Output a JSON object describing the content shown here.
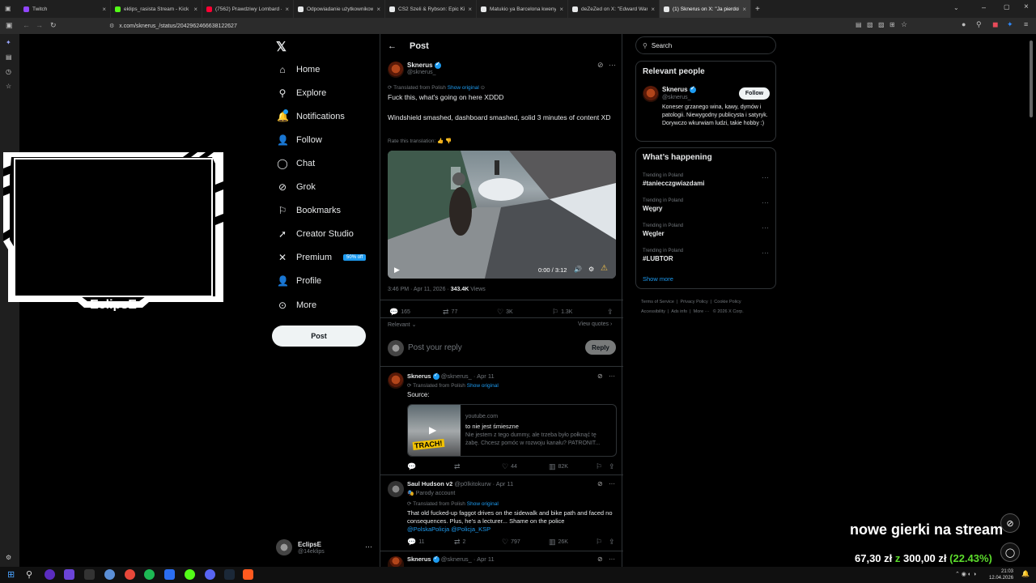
{
  "browser": {
    "tabs": [
      {
        "title": "Twitch",
        "color": "#9146ff"
      },
      {
        "title": "eklips_rasista Stream - Kick Da:",
        "color": "#53fc18"
      },
      {
        "title": "(7562) Prawdziwy Lombard - C:",
        "color": "#ff0033"
      },
      {
        "title": "Odpowiadanie użytkownikowi",
        "color": "#e7e9ea"
      },
      {
        "title": "CS2 Szeli & Rybson: Epic KickT",
        "color": "#e7e9ea"
      },
      {
        "title": "Matukio ya Barcelona kwenye",
        "color": "#e7e9ea"
      },
      {
        "title": "deZeZed on X: \"Edward Warch:",
        "color": "#e7e9ea"
      },
      {
        "title": "(1) Sknerus on X: \"Ja pierdole",
        "color": "#e7e9ea"
      }
    ],
    "url": "x.com/sknerus_/status/2042962466638122627"
  },
  "overlay": {
    "cam_name": "EclipsE",
    "stream_message": "nowe gierki na stream",
    "goal_current": "67,30 zł",
    "goal_sep": "z",
    "goal_target": "300,00 zł",
    "goal_percent": "(22.43%)"
  },
  "nav": {
    "items": [
      {
        "label": "Home",
        "icon": "home-icon"
      },
      {
        "label": "Explore",
        "icon": "search-icon"
      },
      {
        "label": "Notifications",
        "icon": "bell-icon"
      },
      {
        "label": "Follow",
        "icon": "follow-icon"
      },
      {
        "label": "Chat",
        "icon": "chat-icon"
      },
      {
        "label": "Grok",
        "icon": "grok-icon"
      },
      {
        "label": "Bookmarks",
        "icon": "bookmark-icon"
      },
      {
        "label": "Creator Studio",
        "icon": "rocket-icon"
      },
      {
        "label": "Premium",
        "icon": "x-icon"
      },
      {
        "label": "Profile",
        "icon": "profile-icon"
      },
      {
        "label": "More",
        "icon": "more-icon"
      }
    ],
    "premium_badge": "50% off",
    "post_button": "Post",
    "account_name": "EclipsE",
    "account_handle": "@14eklips"
  },
  "post": {
    "header_title": "Post",
    "author_name": "Sknerus",
    "author_handle": "@sknerus_",
    "translated_label": "Translated from Polish",
    "show_original": "Show original",
    "text1": "Fuck this, what's going on here XDDD",
    "text2": "Windshield smashed, dashboard smashed, solid 3 minutes of content XD",
    "rate_translation": "Rate this translation:",
    "video_time": "0:00 / 3:12",
    "timestamp": "3:46 PM · Apr 11, 2026 ·",
    "views_count": "343.4K",
    "views_label": "Views",
    "replies": "165",
    "reposts": "77",
    "likes": "3K",
    "bookmarks": "1.3K",
    "sort_label": "Relevant",
    "view_quotes": "View quotes",
    "reply_placeholder": "Post your reply",
    "reply_button": "Reply"
  },
  "replies": [
    {
      "name": "Sknerus",
      "handle": "@sknerus_ · Apr 11",
      "translated_label": "Translated from Polish",
      "show_original": "Show original",
      "text": "Source:",
      "card_domain": "youtube.com",
      "card_title": "to nie jest śmieszne",
      "card_desc": "Nie jestem z tego dummy, ale trzeba było połknąć tę żabę. Chcesz pomóc w rozwoju kanału? PATRONIT...",
      "thumb_label": "TRACH!",
      "replies": "",
      "reposts": "",
      "likes": "44",
      "views": "82K"
    },
    {
      "name": "Saul Hudson v2",
      "handle": "@p0lkitokurw · Apr 11",
      "parody": "Parody account",
      "translated_label": "Translated from Polish",
      "show_original": "Show original",
      "text": "That old fucked-up faggot drives on the sidewalk and bike path and faced no consequences. Plus, he's a lecturer... Shame on the police",
      "mentions": "@PolskaPolicja @Policja_KSP",
      "replies": "11",
      "reposts": "2",
      "likes": "797",
      "views": "26K"
    },
    {
      "name": "Sknerus",
      "handle": "@sknerus_ · Apr 11"
    }
  ],
  "right": {
    "search_placeholder": "Search",
    "relevant_title": "Relevant people",
    "person_name": "Sknerus",
    "person_handle": "@sknerus_",
    "follow_button": "Follow",
    "person_bio": "Koneser grzanego wina, kawy, dymów i patologii. Niewygodny publicysta i satyryk. Dorywczo wkurwiam ludzi, takie hobby :)",
    "happening_title": "What’s happening",
    "trends": [
      {
        "category": "Trending in Poland",
        "name": "#taniecczgwiazdami"
      },
      {
        "category": "Trending in Poland",
        "name": "Węgry"
      },
      {
        "category": "Trending in Poland",
        "name": "Węgler"
      },
      {
        "category": "Trending in Poland",
        "name": "#LUBTOR"
      }
    ],
    "show_more": "Show more",
    "footer": [
      "Terms of Service",
      "Privacy Policy",
      "Cookie Policy",
      "Accessibility",
      "Ads info",
      "More ···",
      "© 2026 X Corp."
    ]
  },
  "taskbar": {
    "time": "21:03",
    "date": "12.04.2026"
  }
}
